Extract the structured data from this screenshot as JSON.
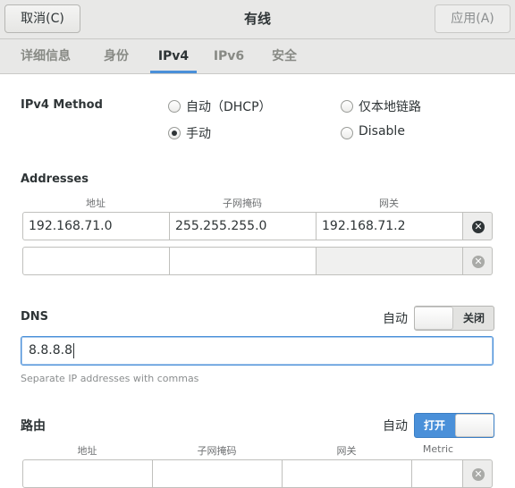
{
  "header": {
    "cancel_label": "取消(C)",
    "title": "有线",
    "apply_label": "应用(A)"
  },
  "tabs": [
    {
      "label": "详细信息"
    },
    {
      "label": "身份"
    },
    {
      "label": "IPv4"
    },
    {
      "label": "IPv6"
    },
    {
      "label": "安全"
    }
  ],
  "active_tab": "IPv4",
  "ipv4": {
    "method_label": "IPv4 Method",
    "methods": [
      {
        "label": "自动（DHCP）",
        "checked": false
      },
      {
        "label": "仅本地链路",
        "checked": false
      },
      {
        "label": "手动",
        "checked": true
      },
      {
        "label": "Disable",
        "checked": false
      }
    ]
  },
  "addresses": {
    "heading": "Addresses",
    "columns": [
      "地址",
      "子网掩码",
      "网关"
    ],
    "rows": [
      [
        "192.168.71.0",
        "255.255.255.0",
        "192.168.71.2"
      ],
      [
        "",
        "",
        ""
      ]
    ]
  },
  "dns": {
    "heading": "DNS",
    "auto_label": "自动",
    "switch_label": "关闭",
    "switch_on": false,
    "value": "8.8.8.8",
    "hint": "Separate IP addresses with commas"
  },
  "routes": {
    "heading": "路由",
    "auto_label": "自动",
    "switch_label": "打开",
    "switch_on": true,
    "columns": [
      "地址",
      "子网掩码",
      "网关",
      "Metric"
    ]
  },
  "icons": {
    "delete": "close-circle-icon"
  },
  "colors": {
    "accent": "#4a90d9",
    "header_bg": "#e8e8e7"
  }
}
